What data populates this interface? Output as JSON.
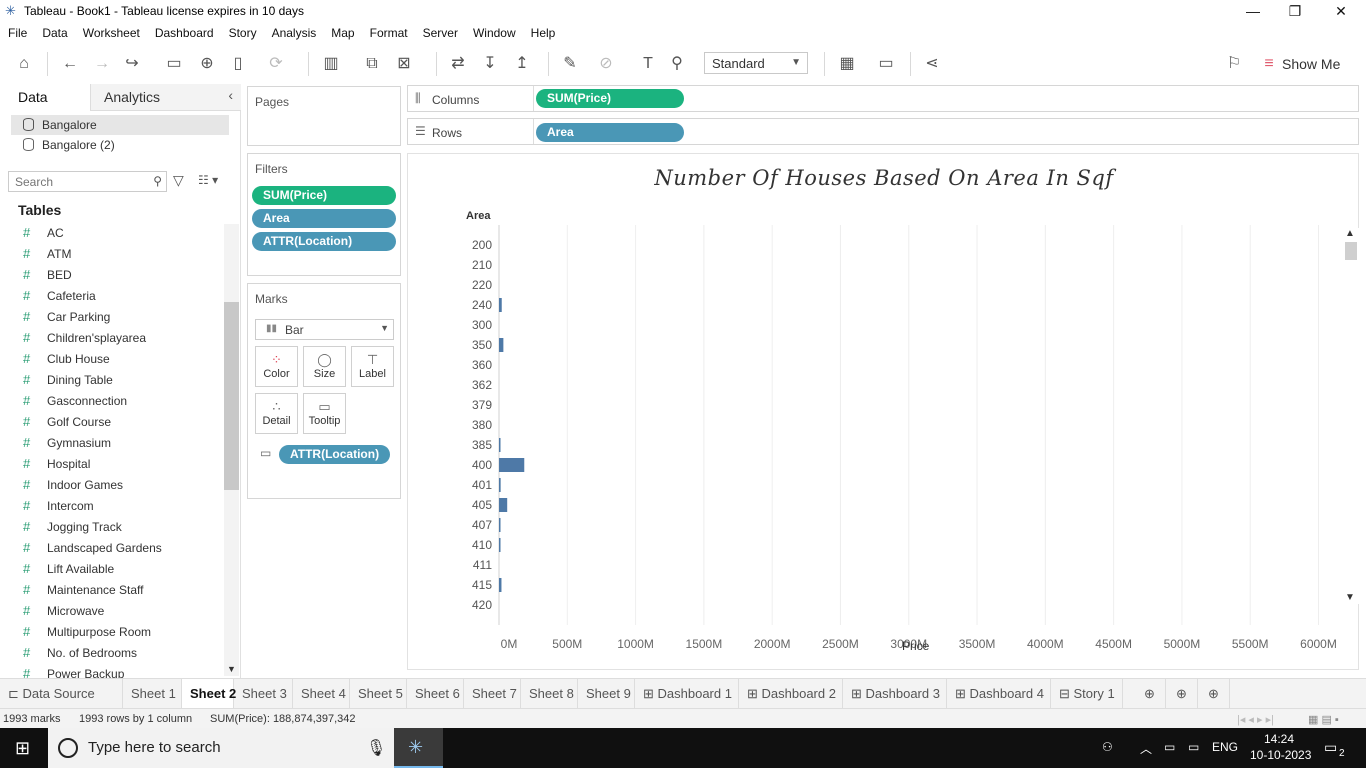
{
  "window": {
    "title": "Tableau - Book1 - Tableau license expires in 10 days",
    "minimize": "—",
    "restore": "❐",
    "close": "✕"
  },
  "menu": [
    "File",
    "Data",
    "Worksheet",
    "Dashboard",
    "Story",
    "Analysis",
    "Map",
    "Format",
    "Server",
    "Window",
    "Help"
  ],
  "toolbar": {
    "fit_select": "Standard",
    "show_me": "Show Me"
  },
  "left_pane": {
    "tab_data": "Data",
    "tab_analytics": "Analytics",
    "collapse": "‹",
    "datasources": [
      "Bangalore",
      "Bangalore (2)"
    ],
    "search_placeholder": "Search",
    "tables_title": "Tables",
    "fields": [
      "AC",
      "ATM",
      "BED",
      "Cafeteria",
      "Car Parking",
      "Children'splayarea",
      "Club House",
      "Dining Table",
      "Gasconnection",
      "Golf Course",
      "Gymnasium",
      "Hospital",
      "Indoor Games",
      "Intercom",
      "Jogging Track",
      "Landscaped Gardens",
      "Lift Available",
      "Maintenance Staff",
      "Microwave",
      "Multipurpose Room",
      "No. of Bedrooms",
      "Power Backup"
    ]
  },
  "pages": {
    "label": "Pages"
  },
  "filters": {
    "label": "Filters",
    "pills": [
      "SUM(Price)",
      "Area",
      "ATTR(Location)"
    ]
  },
  "marks": {
    "label": "Marks",
    "type": "Bar",
    "buttons": [
      "Color",
      "Size",
      "Label",
      "Detail",
      "Tooltip"
    ],
    "tooltip_pill": "ATTR(Location)"
  },
  "shelves": {
    "columns_label": "Columns",
    "columns_pill": "SUM(Price)",
    "rows_label": "Rows",
    "rows_pill": "Area"
  },
  "chart_data": {
    "type": "bar",
    "orientation": "horizontal",
    "title": "Number Of Houses Based On Area In Sqf",
    "ylabel": "Area",
    "xlabel": "Price",
    "categories": [
      "200",
      "210",
      "220",
      "240",
      "300",
      "350",
      "360",
      "362",
      "379",
      "380",
      "385",
      "400",
      "401",
      "405",
      "407",
      "410",
      "411",
      "415",
      "420"
    ],
    "values": [
      0,
      0,
      0,
      20,
      0,
      32,
      0,
      0,
      0,
      0,
      10,
      185,
      12,
      60,
      10,
      5,
      0,
      18,
      0
    ],
    "x_ticks": [
      "0M",
      "500M",
      "1000M",
      "1500M",
      "2000M",
      "2500M",
      "3000M",
      "3500M",
      "4000M",
      "4500M",
      "5000M",
      "5500M",
      "6000M"
    ],
    "xlim": [
      0,
      6150
    ],
    "units": "M",
    "bar_color": "#4e79a7",
    "grid": true
  },
  "sheet_tabs": [
    "Data Source",
    "Sheet 1",
    "Sheet 2",
    "Sheet 3",
    "Sheet 4",
    "Sheet 5",
    "Sheet 6",
    "Sheet 7",
    "Sheet 8",
    "Sheet 9",
    "Dashboard 1",
    "Dashboard 2",
    "Dashboard 3",
    "Dashboard 4",
    "Story 1"
  ],
  "active_tab": "Sheet 2",
  "status": {
    "marks": "1993 marks",
    "rows": "1993 rows by 1 column",
    "sum": "SUM(Price): 188,874,397,342"
  },
  "taskbar": {
    "search_placeholder": "Type here to search",
    "lang": "ENG",
    "time": "14:24",
    "date": "10-10-2023",
    "notifications": "2"
  }
}
